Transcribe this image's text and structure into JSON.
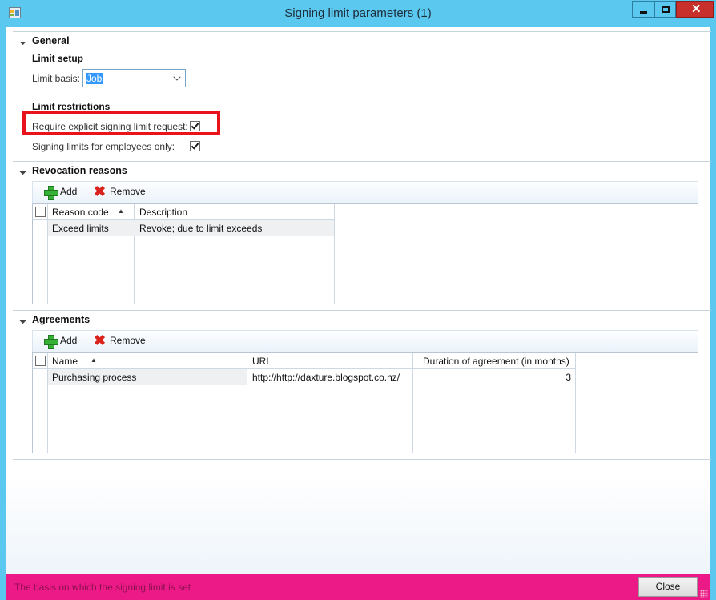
{
  "window": {
    "title": "Signing limit parameters (1)"
  },
  "general": {
    "heading": "General",
    "limit_setup": {
      "heading": "Limit setup",
      "limit_basis_label": "Limit basis:",
      "limit_basis_value": "Job"
    },
    "limit_restrictions": {
      "heading": "Limit restrictions",
      "require_explicit_label": "Require explicit signing limit request:",
      "require_explicit_checked": true,
      "employees_only_label": "Signing limits for employees only:",
      "employees_only_checked": true
    }
  },
  "revocation": {
    "heading": "Revocation reasons",
    "toolbar": {
      "add_label": "Add",
      "remove_label": "Remove"
    },
    "columns": [
      "Reason code",
      "Description"
    ],
    "rows": [
      {
        "reason_code": "Exceed limits",
        "description": "Revoke; due to limit exceeds"
      }
    ]
  },
  "agreements": {
    "heading": "Agreements",
    "toolbar": {
      "add_label": "Add",
      "remove_label": "Remove"
    },
    "columns": [
      "Name",
      "URL",
      "Duration of agreement (in months)"
    ],
    "rows": [
      {
        "name": "Purchasing process",
        "url": "http://http://daxture.blogspot.co.nz/",
        "duration": "3"
      }
    ]
  },
  "status": {
    "message": "The basis on which the signing limit is set",
    "close_label": "Close",
    "status_color": "#ec1a86"
  }
}
